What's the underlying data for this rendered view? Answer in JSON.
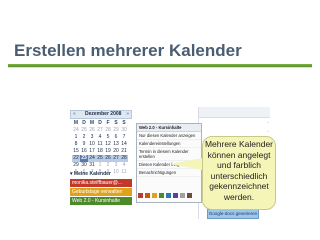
{
  "slide": {
    "title": "Erstellen mehrerer Kalender"
  },
  "calendar": {
    "month_title": "Dezember 2008",
    "prev": "«",
    "next": "»",
    "weekdays": [
      "M",
      "D",
      "M",
      "D",
      "F",
      "S",
      "S"
    ],
    "weeks": [
      [
        "24",
        "25",
        "26",
        "27",
        "28",
        "29",
        "30"
      ],
      [
        "1",
        "2",
        "3",
        "4",
        "5",
        "6",
        "7"
      ],
      [
        "8",
        "9",
        "10",
        "11",
        "12",
        "13",
        "14"
      ],
      [
        "15",
        "16",
        "17",
        "18",
        "19",
        "20",
        "21"
      ],
      [
        "22",
        "23",
        "24",
        "25",
        "26",
        "27",
        "28"
      ],
      [
        "29",
        "30",
        "31",
        "1",
        "2",
        "3",
        "4"
      ],
      [
        "5",
        "6",
        "7",
        "8",
        "9",
        "10",
        "11"
      ]
    ]
  },
  "calendar_list": {
    "header": "Meine Kalender",
    "items": [
      {
        "label": "monika.steiffbauer@...",
        "color": "#c0392b"
      },
      {
        "label": "Geburtstage verwalten",
        "color": "#e0a21b"
      },
      {
        "label": "Web 2.0 - Kursinhalte",
        "color": "#4d8a2a"
      }
    ]
  },
  "context_menu": {
    "header": "Web 2.0 - Kursinhalte",
    "items": [
      "Nur diesen Kalender anzeigen",
      "Kalendereinstellungen",
      "Termin in diesem Kalender erstellen",
      "Diesen Kalender freigeben",
      "Benachrichtigungen"
    ],
    "swatch_colors": [
      "#c0392b",
      "#d35400",
      "#e0a21b",
      "#4d8a2a",
      "#2a7ab0",
      "#5b3ea8",
      "#a0a0a0",
      "#6d4c41"
    ]
  },
  "right_pane": {
    "link_label": "Google-docs generieren"
  },
  "callout": {
    "text": "Mehrere Kalender können angelegt und farblich unterschiedlich gekennzeichnet werden."
  }
}
